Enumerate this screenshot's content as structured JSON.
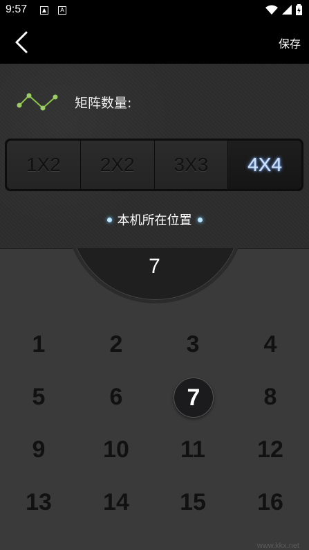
{
  "status_bar": {
    "time": "9:57"
  },
  "header": {
    "save_label": "保存"
  },
  "matrix": {
    "label": "矩阵数量:",
    "options": [
      "1X2",
      "2X2",
      "3X3",
      "4X4"
    ],
    "selected": "4X4"
  },
  "location": {
    "label": "本机所在位置"
  },
  "dial": {
    "value": "7"
  },
  "grid": {
    "numbers": [
      "1",
      "2",
      "3",
      "4",
      "5",
      "6",
      "7",
      "8",
      "9",
      "10",
      "11",
      "12",
      "13",
      "14",
      "15",
      "16"
    ],
    "selected": "7"
  },
  "watermark": "www.kkx.net"
}
